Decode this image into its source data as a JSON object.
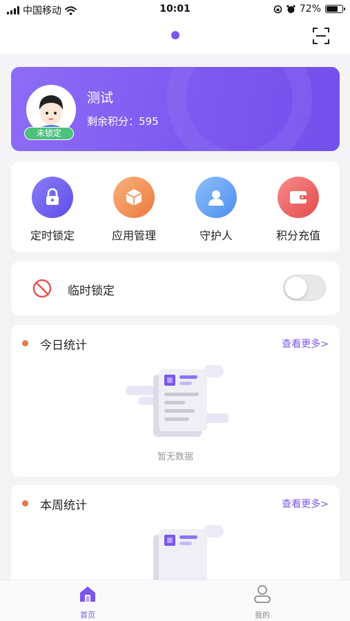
{
  "status_bar": {
    "carrier": "中国移动",
    "time": "10:01",
    "battery": "72%",
    "battery_level": 0.72
  },
  "profile": {
    "name": "测试",
    "points_label": "剩余积分：",
    "points_value": "595",
    "lock_status": "未锁定"
  },
  "menu": [
    {
      "label": "定时锁定",
      "icon": "lock-icon",
      "color": "#6a5cf0"
    },
    {
      "label": "应用管理",
      "icon": "cube-icon",
      "color": "#f08a4e"
    },
    {
      "label": "守护人",
      "icon": "person-icon",
      "color": "#5b9df5"
    },
    {
      "label": "积分充值",
      "icon": "wallet-icon",
      "color": "#ee5a5a"
    }
  ],
  "temp_lock": {
    "label": "临时锁定",
    "enabled": false
  },
  "today_stats": {
    "title": "今日统计",
    "more": "查看更多>",
    "empty_text": "暂无数据"
  },
  "week_stats": {
    "title": "本周统计",
    "more": "查看更多>"
  },
  "tabs": [
    {
      "label": "首页",
      "icon": "home-icon",
      "active": true,
      "color": "#7a55ee"
    },
    {
      "label": "我的",
      "icon": "user-icon",
      "active": false,
      "color": "#8a8a90"
    }
  ]
}
